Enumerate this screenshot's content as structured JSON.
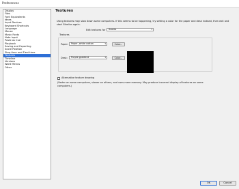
{
  "window": {
    "title": "Preferences"
  },
  "sidebar": {
    "items": [
      {
        "label": "Display"
      },
      {
        "label": "Files"
      },
      {
        "label": "Font Equivalents"
      },
      {
        "label": "Ideas"
      },
      {
        "label": "Input Devices"
      },
      {
        "label": "Keyboard Shortcuts"
      },
      {
        "label": "Language"
      },
      {
        "label": "Mouse"
      },
      {
        "label": "Music Fonts"
      },
      {
        "label": "Note Input"
      },
      {
        "label": "Paste as Cue"
      },
      {
        "label": "Playback"
      },
      {
        "label": "Saving and Exporting"
      },
      {
        "label": "Score Position"
      },
      {
        "label": "Step-time and Flexi-time"
      },
      {
        "label": "Textures",
        "selected": true
      },
      {
        "label": "Timeline"
      },
      {
        "label": "Versions"
      },
      {
        "label": "Word Menus"
      },
      {
        "label": "Other"
      }
    ]
  },
  "main": {
    "heading": "Textures",
    "intro": "Using textures may slow down some computers. If this seems to be happening, try setting a color for the paper and desk instead, then exit and start Sibelius again.",
    "edit_label": "Edit textures for",
    "edit_value": "Scores",
    "textures_label": "Textures",
    "paper_label": "Paper:",
    "paper_value": "Paper, white cotton",
    "desk_label": "Desk:",
    "desk_value": "Purple gradient",
    "color_button_label": "Color...",
    "alt_label": "Alternative texture drawing",
    "alt_checked": false,
    "note": "(Faster on some computers, slower on others, and uses more memory. May produce incorrect display of textures on some computers.)"
  },
  "footer": {
    "ok_label": "OK",
    "cancel_label": "Cancel"
  },
  "colors": {
    "selection": "#2e6fd6",
    "preview": "#000000"
  }
}
